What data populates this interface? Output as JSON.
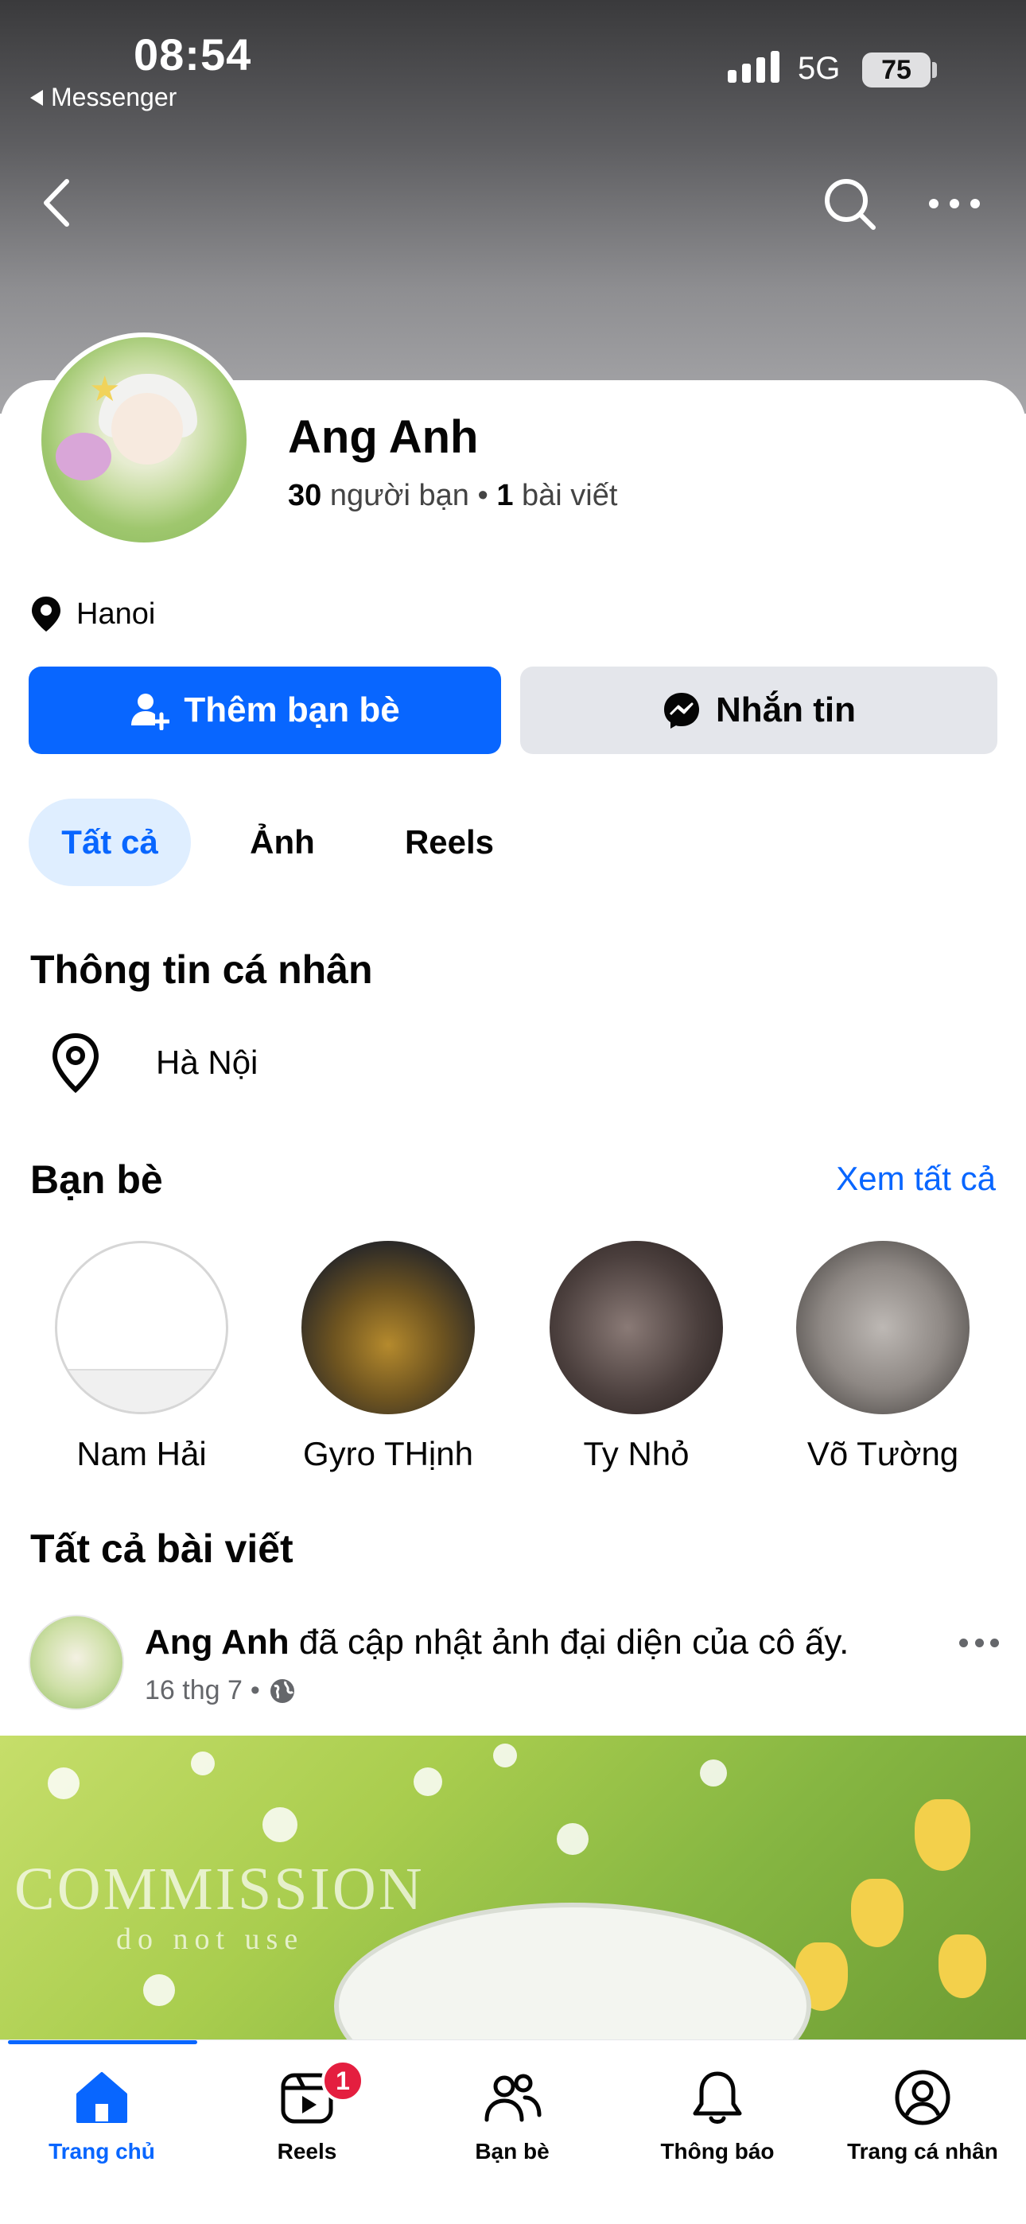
{
  "status_bar": {
    "time": "08:54",
    "back_app": "Messenger",
    "network": "5G",
    "battery": "75"
  },
  "profile": {
    "name": "Ang Anh",
    "friends_count": "30",
    "friends_label": "người bạn",
    "separator": "•",
    "posts_count": "1",
    "posts_label": "bài viết",
    "location": "Hanoi"
  },
  "actions": {
    "add_friend": "Thêm bạn bè",
    "message": "Nhắn tin"
  },
  "tabs": [
    {
      "label": "Tất cả",
      "active": true
    },
    {
      "label": "Ảnh",
      "active": false
    },
    {
      "label": "Reels",
      "active": false
    }
  ],
  "personal_info": {
    "title": "Thông tin cá nhân",
    "city": "Hà Nội"
  },
  "friends": {
    "title": "Bạn bè",
    "see_all": "Xem tất cả",
    "items": [
      {
        "name": "Nam Hải"
      },
      {
        "name": "Gyro THịnh"
      },
      {
        "name": "Ty Nhỏ"
      },
      {
        "name": "Võ Tường"
      }
    ]
  },
  "posts": {
    "title": "Tất cả bài viết",
    "items": [
      {
        "author": "Ang Anh",
        "action": "đã cập nhật ảnh đại diện của cô ấy.",
        "date": "16 thg 7",
        "dot": "•",
        "watermark_line1": "COMMISSION",
        "watermark_line2": "do not use"
      }
    ]
  },
  "tabbar": {
    "items": [
      {
        "label": "Trang chủ",
        "icon": "home-icon",
        "active": true
      },
      {
        "label": "Reels",
        "icon": "reels-icon",
        "badge": "1"
      },
      {
        "label": "Bạn bè",
        "icon": "friends-icon"
      },
      {
        "label": "Thông báo",
        "icon": "bell-icon"
      },
      {
        "label": "Trang cá nhân",
        "icon": "profile-icon"
      }
    ]
  },
  "colors": {
    "accent": "#0866ff",
    "badge": "#e41e3f",
    "secondary_button": "#e4e6eb",
    "active_tab_bg": "#dfeeff"
  }
}
